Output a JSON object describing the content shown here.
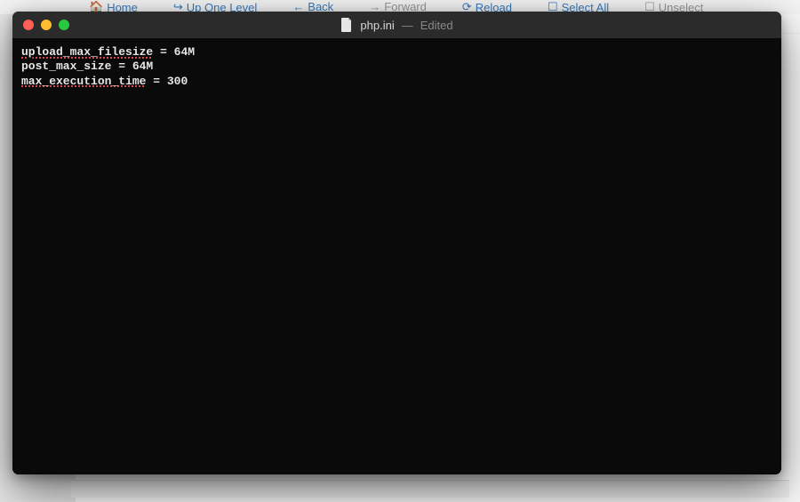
{
  "background": {
    "toolbar": {
      "home": "Home",
      "up": "Up One Level",
      "back": "Back",
      "forward": "Forward",
      "reload": "Reload",
      "selectall": "Select All",
      "unselect": "Unselect"
    }
  },
  "window": {
    "filename": "php.ini",
    "separator": "—",
    "edited_label": "Edited"
  },
  "editor": {
    "lines": [
      {
        "key": "upload_max_filesize",
        "op": " = ",
        "val": "64M",
        "key_spell": true
      },
      {
        "key": "post_max_size",
        "op": " = ",
        "val": "64M",
        "key_spell": false
      },
      {
        "key": "max_execution_time",
        "op": " = ",
        "val": "300",
        "key_spell": true
      }
    ]
  }
}
